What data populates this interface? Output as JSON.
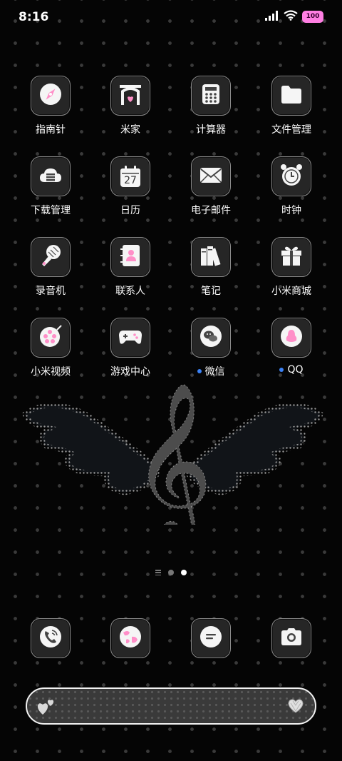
{
  "status": {
    "time": "8:16",
    "battery": "100"
  },
  "apps": [
    {
      "label": "指南针",
      "icon": "compass-icon"
    },
    {
      "label": "米家",
      "icon": "mihome-icon"
    },
    {
      "label": "计算器",
      "icon": "calculator-icon"
    },
    {
      "label": "文件管理",
      "icon": "folder-icon"
    },
    {
      "label": "下载管理",
      "icon": "download-cloud-icon"
    },
    {
      "label": "日历",
      "icon": "calendar-icon",
      "date": "27"
    },
    {
      "label": "电子邮件",
      "icon": "mail-icon"
    },
    {
      "label": "时钟",
      "icon": "clock-icon"
    },
    {
      "label": "录音机",
      "icon": "microphone-icon"
    },
    {
      "label": "联系人",
      "icon": "contacts-icon"
    },
    {
      "label": "笔记",
      "icon": "notes-icon"
    },
    {
      "label": "小米商城",
      "icon": "gift-icon"
    },
    {
      "label": "小米视频",
      "icon": "video-icon"
    },
    {
      "label": "游戏中心",
      "icon": "gamepad-icon"
    },
    {
      "label": "微信",
      "icon": "wechat-icon",
      "badge": true
    },
    {
      "label": "QQ",
      "icon": "qq-icon",
      "badge": true
    }
  ],
  "dock": [
    {
      "icon": "phone-icon"
    },
    {
      "icon": "browser-icon"
    },
    {
      "icon": "messages-icon"
    },
    {
      "icon": "camera-icon"
    }
  ],
  "widget": {
    "icon": "treble-clef-wings-icon"
  },
  "page_indicator": {
    "pages": 2,
    "current": 2
  },
  "colors": {
    "accent_pink": "#ff8fc8",
    "badge_blue": "#3b82f6",
    "tile_bg": "#262626"
  }
}
